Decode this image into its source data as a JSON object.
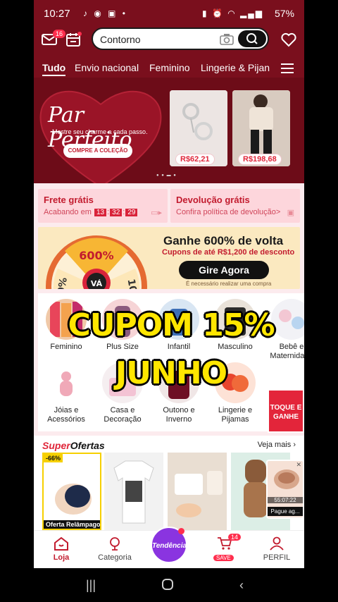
{
  "status_bar": {
    "time": "10:27",
    "battery": "57%"
  },
  "header": {
    "mail_badge": "16",
    "search_text": "Contorno"
  },
  "tabs": [
    "Tudo",
    "Envio nacional",
    "Feminino",
    "Lingerie & Pijan"
  ],
  "banner": {
    "title": "Par Perfeito",
    "subtitle": "Mostre seu charme a cada passo.",
    "cta": "COMPRE A COLEÇÃO",
    "products": [
      {
        "price": "R$62,21"
      },
      {
        "price": "R$198,68"
      }
    ]
  },
  "promos": {
    "free_shipping": {
      "title": "Frete grátis",
      "sub": "Acabando em",
      "timer": [
        "13",
        "32",
        "29"
      ]
    },
    "returns": {
      "title": "Devolução grátis",
      "sub": "Confira política de devolução>"
    }
  },
  "wheel_banner": {
    "wheel_top": "600%",
    "wheel_center": "VÁ",
    "wheel_left": "00%",
    "wheel_right": "100",
    "title": "Ganhe 600% de volta",
    "subtitle": "Cupons de até R$1,200 de desconto",
    "cta": "Gire Agora",
    "note": "É necessário realizar uma compra"
  },
  "categories": [
    {
      "label": "Feminino"
    },
    {
      "label": "Plus Size"
    },
    {
      "label": "Infantil"
    },
    {
      "label": "Masculino"
    },
    {
      "label": "Bebê e Maternidade"
    },
    {
      "label": "Jóias e Acessórios"
    },
    {
      "label": "Casa e Decoração"
    },
    {
      "label": "Outono e Inverno"
    },
    {
      "label": "Lingerie e Pijamas"
    }
  ],
  "toque_ganhe": "TOQUE E GANHE",
  "overlay": {
    "line1": "CUPOM 15%",
    "line2": "JUNHO"
  },
  "super_offers": {
    "title_a": "Super",
    "title_b": "Ofertas",
    "more": "Veja mais",
    "discount": "-66%",
    "offer_label": "Oferta Relâmpago",
    "video_time": "55:07:22",
    "video_cta": "Pague ag..."
  },
  "bottom_nav": {
    "loja": "Loja",
    "categoria": "Categoria",
    "tendencias": "Tendências",
    "cart_badge": "14",
    "cart_save": "SAVE",
    "perfil": "PERFIL"
  },
  "colors": {
    "brand_red": "#c21b2e",
    "header_bg": "#7a0f1d",
    "trend_purple": "#8a34e0",
    "overlay_yellow": "#ffe600"
  }
}
